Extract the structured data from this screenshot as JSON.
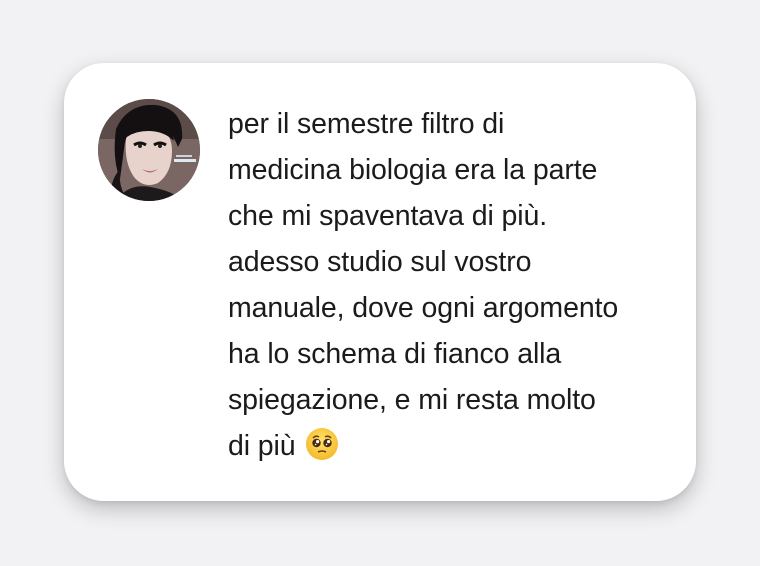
{
  "comment": {
    "lines": [
      "per il semestre filtro di",
      "medicina biologia era la parte",
      "che mi spaventava di più.",
      "adesso studio sul vostro",
      "manuale, dove ogni argomento",
      "ha lo schema di fianco alla",
      "spiegazione, e mi resta molto",
      "di più"
    ],
    "emoji": "pleading-face-emoji"
  },
  "colors": {
    "background": "#f2f2f4",
    "card": "#ffffff",
    "text": "#1b1b1d"
  }
}
